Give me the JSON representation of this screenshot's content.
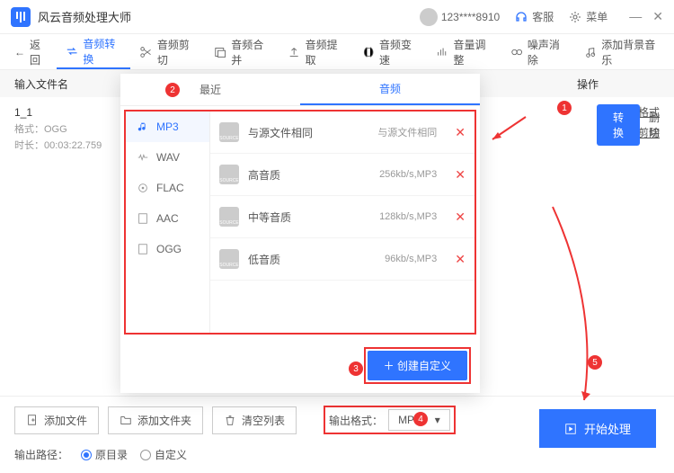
{
  "app": {
    "title": "风云音频处理大师"
  },
  "titlebar": {
    "user": "123****8910",
    "support": "客服",
    "menu": "菜单"
  },
  "toolbar": {
    "back": "返回",
    "convert": "音频转换",
    "cut": "音频剪切",
    "merge": "音频合并",
    "extract": "音频提取",
    "speed": "音频变速",
    "volume": "音量调整",
    "denoise": "噪声消除",
    "bgm": "添加背景音乐"
  },
  "cols": {
    "name": "输入文件名",
    "op": "操作"
  },
  "file": {
    "name": "1_1",
    "format_label": "格式：",
    "format": "OGG",
    "duration_label": "时长：",
    "duration": "00:03:22.759"
  },
  "row_actions": {
    "out_format": "输出格式",
    "audio_cut": "音频剪切",
    "convert": "转换",
    "delete": "删除"
  },
  "panel": {
    "tabs": {
      "recent": "最近",
      "audio": "音频"
    },
    "formats": [
      "MP3",
      "WAV",
      "FLAC",
      "AAC",
      "OGG"
    ],
    "qualities": [
      {
        "label": "与源文件相同",
        "info": "与源文件相同"
      },
      {
        "label": "高音质",
        "info": "256kb/s,MP3"
      },
      {
        "label": "中等音质",
        "info": "128kb/s,MP3"
      },
      {
        "label": "低音质",
        "info": "96kb/s,MP3"
      }
    ],
    "create_custom": "创建自定义"
  },
  "bottom": {
    "add_file": "添加文件",
    "add_folder": "添加文件夹",
    "clear": "清空列表",
    "out_fmt_label": "输出格式：",
    "out_fmt_value": "MP3",
    "start": "开始处理",
    "out_path_label": "输出路径：",
    "same_dir": "原目录",
    "custom_dir": "自定义"
  },
  "annotations": [
    "1",
    "2",
    "3",
    "4",
    "5"
  ]
}
